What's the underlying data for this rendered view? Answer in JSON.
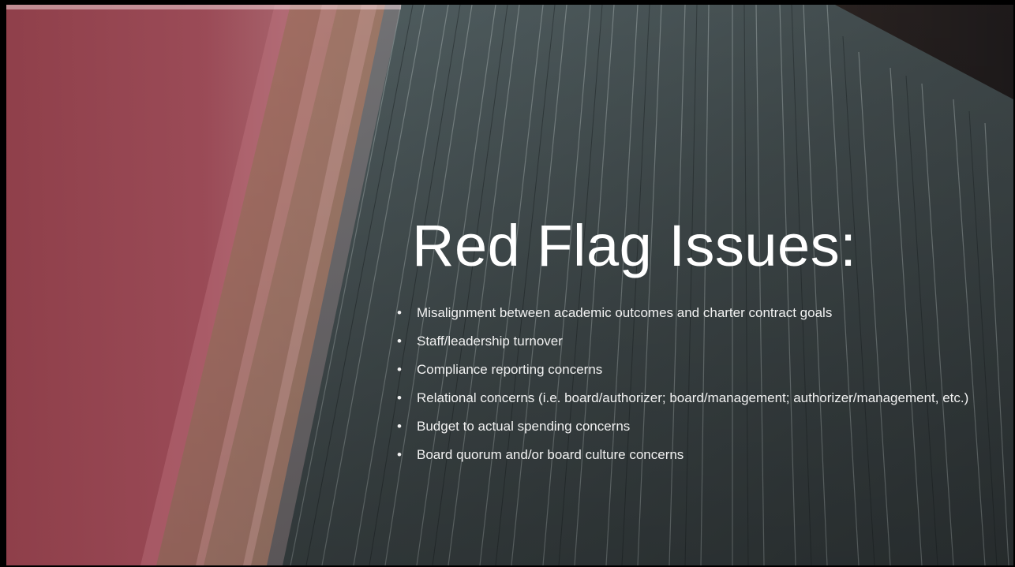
{
  "slide": {
    "title": "Red Flag Issues:",
    "bullets": [
      "Misalignment between academic outcomes and charter contract goals",
      "Staff/leadership turnover",
      "Compliance reporting concerns",
      "Relational concerns (i.e. board/authorizer; board/management; authorizer/management, etc.)",
      "Budget to actual spending concerns",
      "Board quorum and/or board culture concerns"
    ],
    "bullet_glyph": "•"
  },
  "colors": {
    "panel": "#9a4a55",
    "text": "#ffffff"
  }
}
